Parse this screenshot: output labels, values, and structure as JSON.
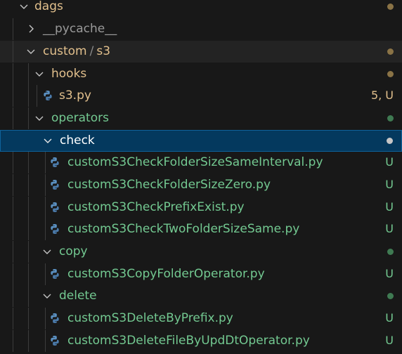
{
  "rows": [
    {
      "label": "dags",
      "deco": ""
    },
    {
      "label": "__pycache__",
      "deco": ""
    },
    {
      "label": "custom",
      "label2": "s3",
      "deco": ""
    },
    {
      "label": "hooks",
      "deco": ""
    },
    {
      "label": "s3.py",
      "deco": "5, U"
    },
    {
      "label": "operators",
      "deco": ""
    },
    {
      "label": "check",
      "deco": ""
    },
    {
      "label": "customS3CheckFolderSizeSameInterval.py",
      "deco": "U"
    },
    {
      "label": "customS3CheckFolderSizeZero.py",
      "deco": "U"
    },
    {
      "label": "customS3CheckPrefixExist.py",
      "deco": "U"
    },
    {
      "label": "customS3CheckTwoFolderSizeSame.py",
      "deco": "U"
    },
    {
      "label": "copy",
      "deco": ""
    },
    {
      "label": "customS3CopyFolderOperator.py",
      "deco": "U"
    },
    {
      "label": "delete",
      "deco": ""
    },
    {
      "label": "customS3DeleteByPrefix.py",
      "deco": "U"
    },
    {
      "label": "customS3DeleteFileByUpdDtOperator.py",
      "deco": "U"
    }
  ],
  "path_separator": "/",
  "colors": {
    "background": "#181818",
    "selection": "#04395e",
    "modified": "#e2c08d",
    "untracked": "#73c991"
  }
}
